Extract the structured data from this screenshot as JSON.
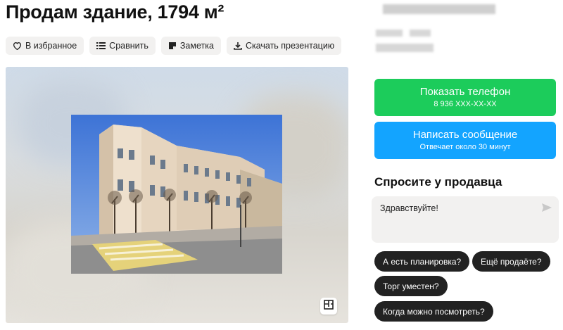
{
  "listing": {
    "title": "Продам здание, 1794 м²"
  },
  "actions": [
    {
      "label": "В избранное",
      "icon": "heart-icon"
    },
    {
      "label": "Сравнить",
      "icon": "compare-icon"
    },
    {
      "label": "Заметка",
      "icon": "note-icon"
    },
    {
      "label": "Скачать презентацию",
      "icon": "download-icon"
    }
  ],
  "gallery": {
    "photo_subject": "building",
    "plan_icon": "floor-plan-icon"
  },
  "contact": {
    "phone_label": "Показать телефон",
    "phone_masked": "8 936 XXX-XX-XX",
    "message_label": "Написать сообщение",
    "message_sub": "Отвечает около 30 минут",
    "phone_color": "#1ccc5b",
    "message_color": "#13a4ff"
  },
  "ask": {
    "title": "Спросите у продавца",
    "input_value": "Здравствуйте!",
    "send_icon": "send-icon",
    "chips": [
      "А есть планировка?",
      "Ещё продаёте?",
      "Торг уместен?",
      "Когда можно посмотреть?"
    ]
  }
}
